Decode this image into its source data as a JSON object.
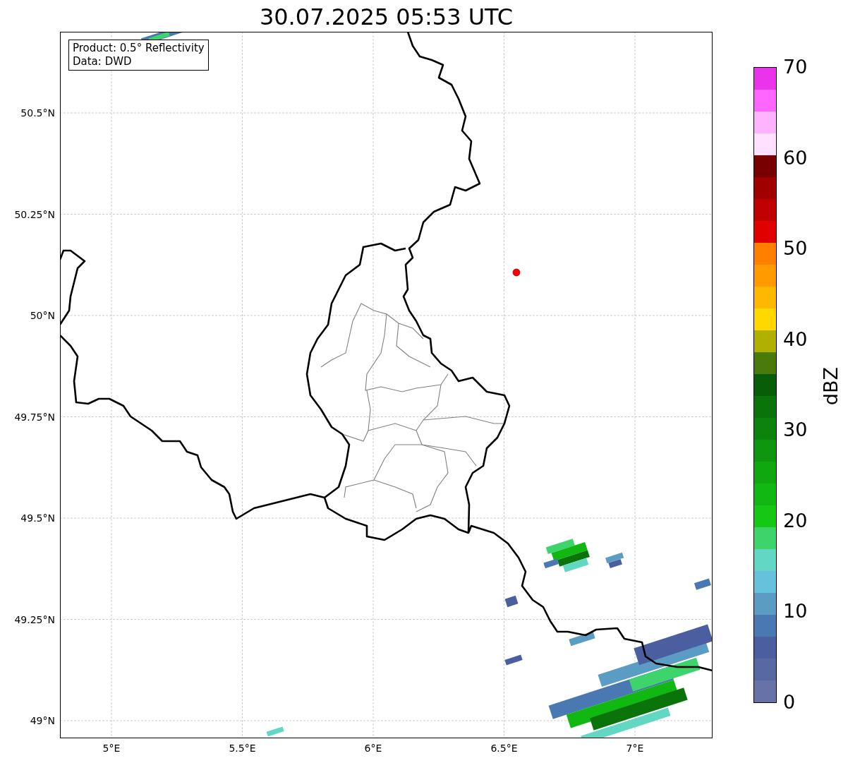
{
  "title": "30.07.2025 05:53 UTC",
  "info_box": [
    "Product: 0.5° Reflectivity",
    "Data: DWD"
  ],
  "map": {
    "lat_labels": [
      "50.5°N",
      "50.25°N",
      "50°N",
      "49.75°N",
      "49.5°N",
      "49.25°N",
      "49°N"
    ],
    "lon_labels": [
      "5°E",
      "5.5°E",
      "6°E",
      "6.5°E",
      "7°E"
    ]
  },
  "colorbar": {
    "label": "dBZ",
    "ticks": [
      "70",
      "60",
      "50",
      "40",
      "30",
      "20",
      "10",
      "0"
    ],
    "segments": [
      {
        "color": "#6672a8"
      },
      {
        "color": "#5868a2"
      },
      {
        "color": "#4a5ea0"
      },
      {
        "color": "#4a78b2"
      },
      {
        "color": "#5a9cc4"
      },
      {
        "color": "#66c2dc"
      },
      {
        "color": "#62d8c4"
      },
      {
        "color": "#3ed46c"
      },
      {
        "color": "#14c814"
      },
      {
        "color": "#12b812"
      },
      {
        "color": "#10a810"
      },
      {
        "color": "#0e960e"
      },
      {
        "color": "#0c840c"
      },
      {
        "color": "#0a740a"
      },
      {
        "color": "#085e08"
      },
      {
        "color": "#4a7a0a"
      },
      {
        "color": "#b0b000"
      },
      {
        "color": "#ffd800"
      },
      {
        "color": "#ffb800"
      },
      {
        "color": "#ff9a00"
      },
      {
        "color": "#ff7f00"
      },
      {
        "color": "#e00000"
      },
      {
        "color": "#c00000"
      },
      {
        "color": "#a00000"
      },
      {
        "color": "#780000"
      },
      {
        "color": "#ffe0ff"
      },
      {
        "color": "#ffb3ff"
      },
      {
        "color": "#ff66ff"
      },
      {
        "color": "#ea33ea"
      }
    ]
  }
}
